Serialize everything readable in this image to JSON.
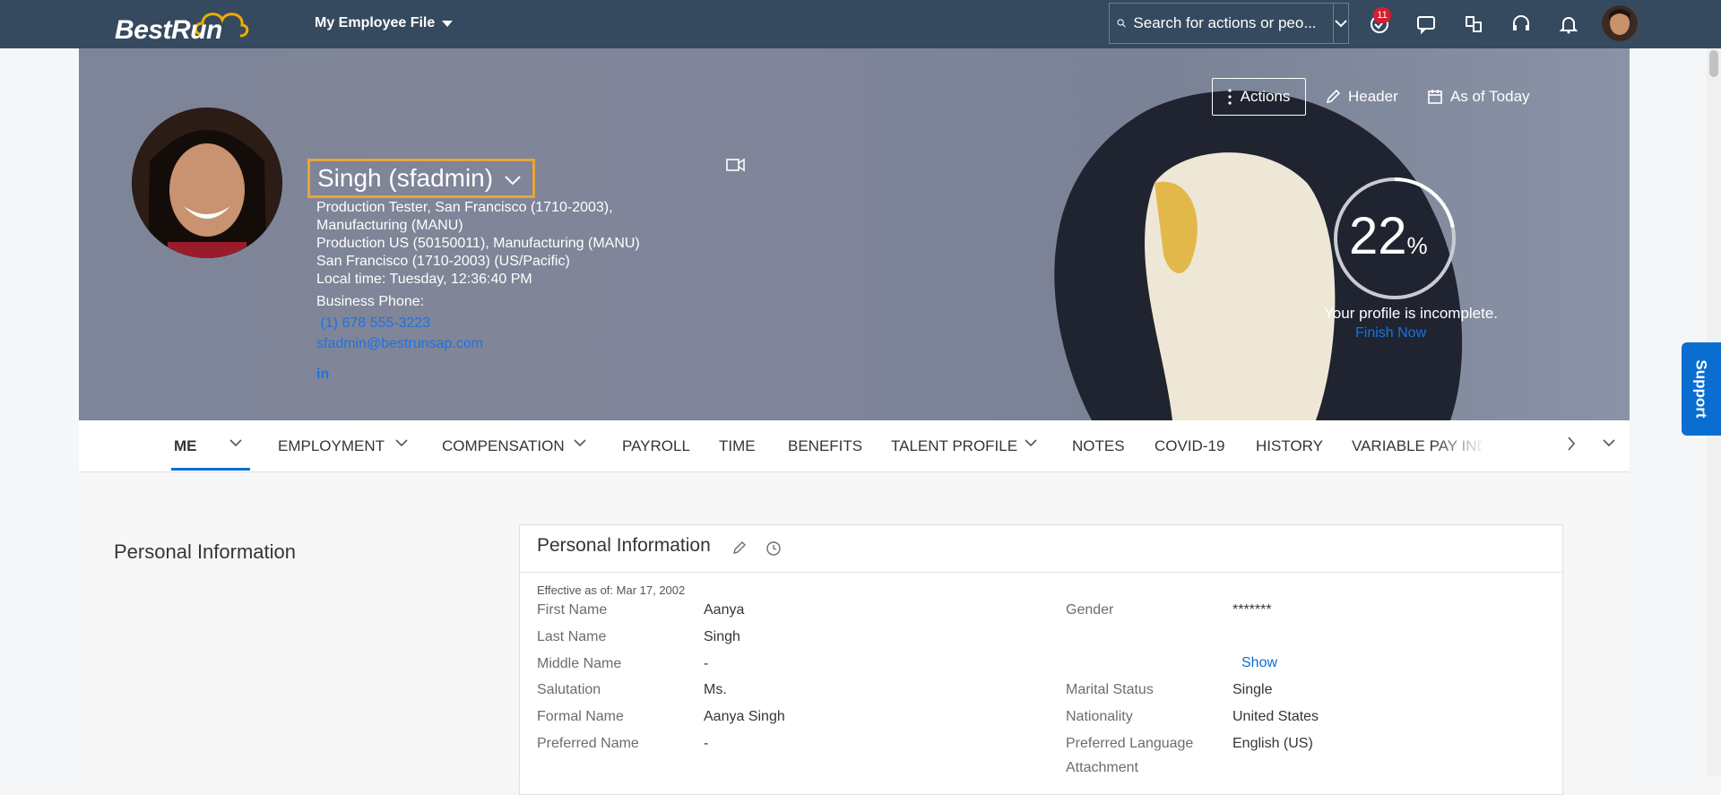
{
  "shell": {
    "logo_text": "BestRun",
    "app_menu_label": "My Employee File",
    "search_placeholder": "Search for actions or peo...",
    "badge_count": "11"
  },
  "hero": {
    "name": "Singh (sfadmin)",
    "lines": [
      "Production Tester, San Francisco (1710-2003),",
      "Manufacturing (MANU)",
      "Production US (50150011), Manufacturing (MANU)",
      "San Francisco (1710-2003) (US/Pacific)",
      "Local time: Tuesday, 12:36:40 PM"
    ],
    "business_phone_label": "Business Phone:",
    "phone": " (1) 678 555-3223",
    "email": "sfadmin@bestrunsap.com",
    "linkedin": "in",
    "actions_label": "Actions",
    "header_label": "Header",
    "as_of_label": "As of Today",
    "profile_percent": 22,
    "profile_number": "22",
    "percent_sign": "%",
    "profile_status": "Your profile is incomplete.",
    "finish_now": "Finish Now"
  },
  "tabs": [
    {
      "label": "ME"
    },
    {
      "label": "EMPLOYMENT"
    },
    {
      "label": "COMPENSATION"
    },
    {
      "label": "PAYROLL"
    },
    {
      "label": "TIME"
    },
    {
      "label": "BENEFITS"
    },
    {
      "label": "TALENT PROFILE"
    },
    {
      "label": "NOTES"
    },
    {
      "label": "COVID-19"
    },
    {
      "label": "HISTORY"
    },
    {
      "label": "VARIABLE PAY INDIVIDUAL V"
    }
  ],
  "personal": {
    "section_title": "Personal Information",
    "card_title": "Personal Information",
    "effective": "Effective as of: Mar 17, 2002",
    "left_fields": [
      {
        "label": "First Name",
        "value": "Aanya"
      },
      {
        "label": "Last Name",
        "value": "Singh"
      },
      {
        "label": "Middle Name",
        "value": "-"
      },
      {
        "label": "Salutation",
        "value": "Ms."
      },
      {
        "label": "Formal Name",
        "value": "Aanya Singh"
      },
      {
        "label": "Preferred Name",
        "value": "-"
      }
    ],
    "gender_label": "Gender",
    "gender_value": "*******",
    "show_label": "Show",
    "right_fields": [
      {
        "label": "Marital Status",
        "value": "Single"
      },
      {
        "label": "Nationality",
        "value": "United States"
      },
      {
        "label": "Preferred Language",
        "value": "English (US)"
      }
    ],
    "attachment_label": "Attachment"
  },
  "support_label": "Support",
  "colors": {
    "shell": "#354a5f",
    "accent": "#0a6ed1",
    "highlight": "#e9a43a",
    "badge": "#d32030"
  }
}
